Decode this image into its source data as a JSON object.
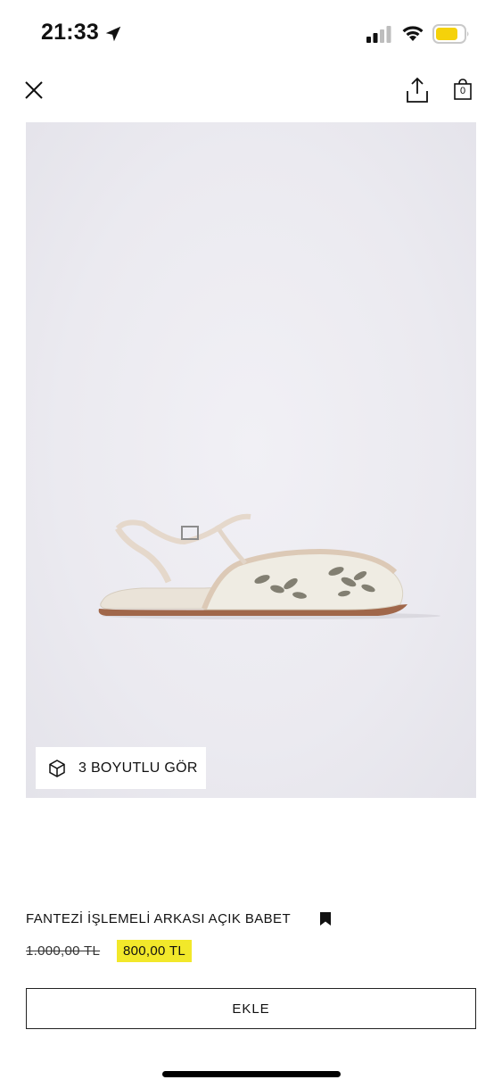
{
  "status_bar": {
    "time": "21:33",
    "battery_color": "#f5d20a"
  },
  "header": {
    "bag_count": "0"
  },
  "gallery": {
    "view_3d_label": "3 BOYUTLU GÖR"
  },
  "product": {
    "name": "FANTEZİ İŞLEMELİ ARKASI AÇIK BABET",
    "old_price": "1.000,00 TL",
    "price": "800,00 TL",
    "price_highlight_color": "#f2e82a"
  },
  "actions": {
    "add_label": "EKLE"
  },
  "icons": [
    "location-arrow-icon",
    "signal-icon",
    "wifi-icon",
    "battery-icon",
    "close-icon",
    "share-icon",
    "shopping-bag-icon",
    "cube-icon",
    "bookmark-icon"
  ]
}
